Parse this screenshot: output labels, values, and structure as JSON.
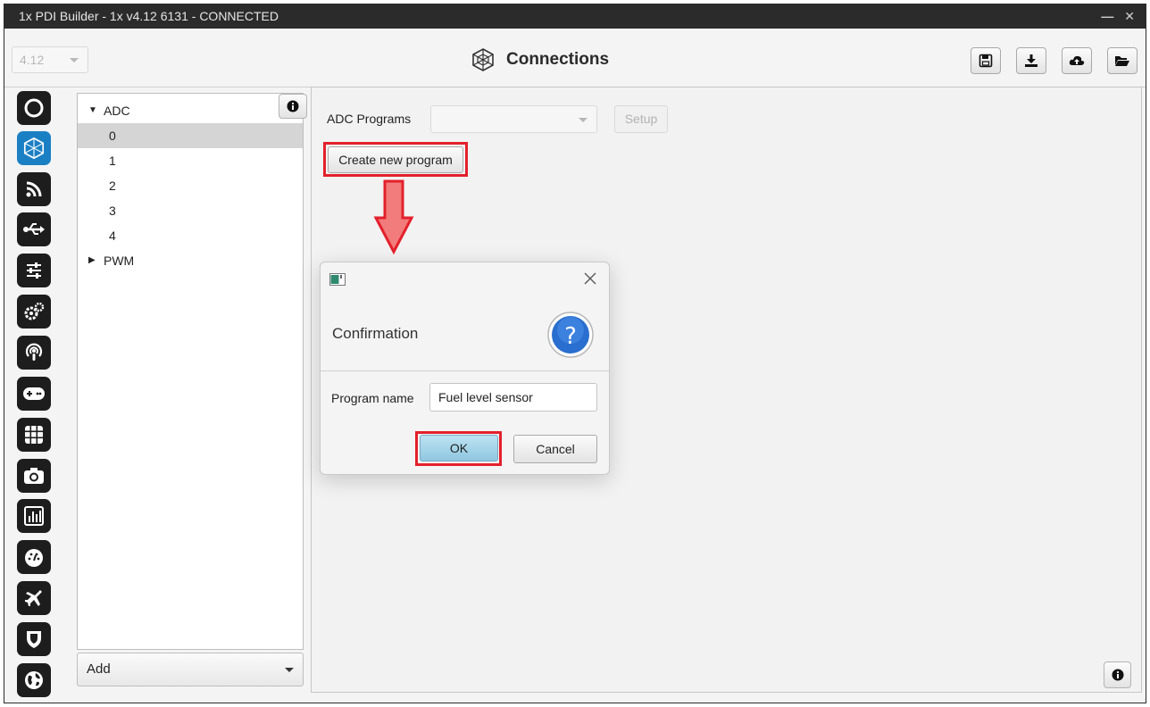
{
  "window": {
    "title": "1x PDI Builder - 1x v4.12 6131 - CONNECTED",
    "controls": "— ✕"
  },
  "toolbar": {
    "version_value": "4.12",
    "page_title": "Connections",
    "buttons": [
      "save-icon",
      "download-icon",
      "cloud-upload-icon",
      "open-folder-icon"
    ]
  },
  "sidebar": {
    "items": [
      "power-icon",
      "connections-icon",
      "feed-icon",
      "usb-icon",
      "sliders-icon",
      "gears-icon",
      "podcast-icon",
      "gamepad-icon",
      "grid-icon",
      "camera-icon",
      "chart-icon",
      "dashboard-icon",
      "plane-icon",
      "shield-icon",
      "globe-icon"
    ]
  },
  "tree": {
    "adc_label": "ADC",
    "adc_children": [
      "0",
      "1",
      "2",
      "3",
      "4"
    ],
    "pwm_label": "PWM",
    "add_label": "Add"
  },
  "main": {
    "programs_label": "ADC Programs",
    "programs_value": "",
    "setup_label": "Setup",
    "create_label": "Create new program"
  },
  "dialog": {
    "heading": "Confirmation",
    "field_label": "Program name",
    "field_value": "Fuel level sensor",
    "ok_label": "OK",
    "cancel_label": "Cancel"
  },
  "colors": {
    "accent": "#1b7fc4",
    "highlight": "#e3202b",
    "arrow": "#f27b7b"
  }
}
